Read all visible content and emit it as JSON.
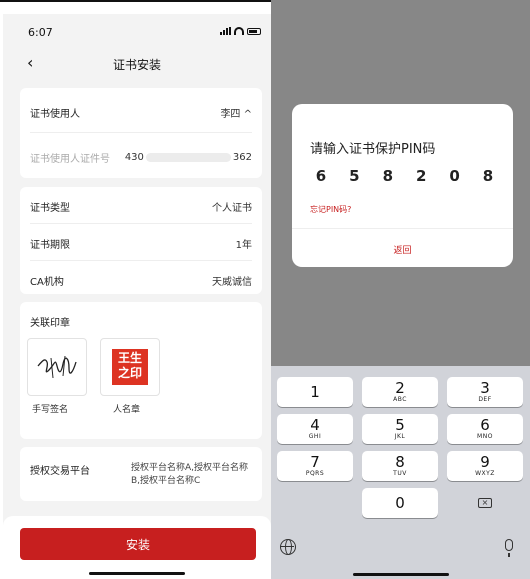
{
  "left": {
    "status": {
      "time": "6:07"
    },
    "nav": {
      "back_glyph": "‹",
      "title": "证书安装"
    },
    "holder": {
      "label": "证书使用人",
      "value": "李四 ^",
      "id_label": "证书使用人证件号",
      "id_value_prefix": "430",
      "id_value_suffix": "362"
    },
    "details": [
      {
        "label": "证书类型",
        "value": "个人证书"
      },
      {
        "label": "证书期限",
        "value": "1年"
      },
      {
        "label": "CA机构",
        "value": "天威诚信"
      }
    ],
    "seals": {
      "title": "关联印章",
      "handwritten_caption": "手写签名",
      "name_seal_caption": "人名章",
      "stamp_text": [
        "王生",
        "之印"
      ]
    },
    "auth": {
      "label": "授权交易平台",
      "value": "授权平台名称A,授权平台名称B,授权平台名称C"
    },
    "install_label": "安装",
    "colors": {
      "brand": "#c71f1f",
      "bg": "#f3f3f3"
    }
  },
  "right": {
    "dialog": {
      "title": "请输入证书保护PIN码",
      "pin": [
        "6",
        "5",
        "8",
        "2",
        "0",
        "8"
      ],
      "forgot": "忘记PIN码?",
      "return": "返回"
    },
    "keyboard": {
      "keys": [
        {
          "d": "1",
          "l": ""
        },
        {
          "d": "2",
          "l": "ABC"
        },
        {
          "d": "3",
          "l": "DEF"
        },
        {
          "d": "4",
          "l": "GHI"
        },
        {
          "d": "5",
          "l": "JKL"
        },
        {
          "d": "6",
          "l": "MNO"
        },
        {
          "d": "7",
          "l": "PQRS"
        },
        {
          "d": "8",
          "l": "TUV"
        },
        {
          "d": "9",
          "l": "WXYZ"
        },
        {
          "d": "0",
          "l": ""
        }
      ],
      "backspace_icon": "delete-left-icon",
      "globe_icon": "globe-icon",
      "mic_icon": "microphone-icon"
    }
  }
}
